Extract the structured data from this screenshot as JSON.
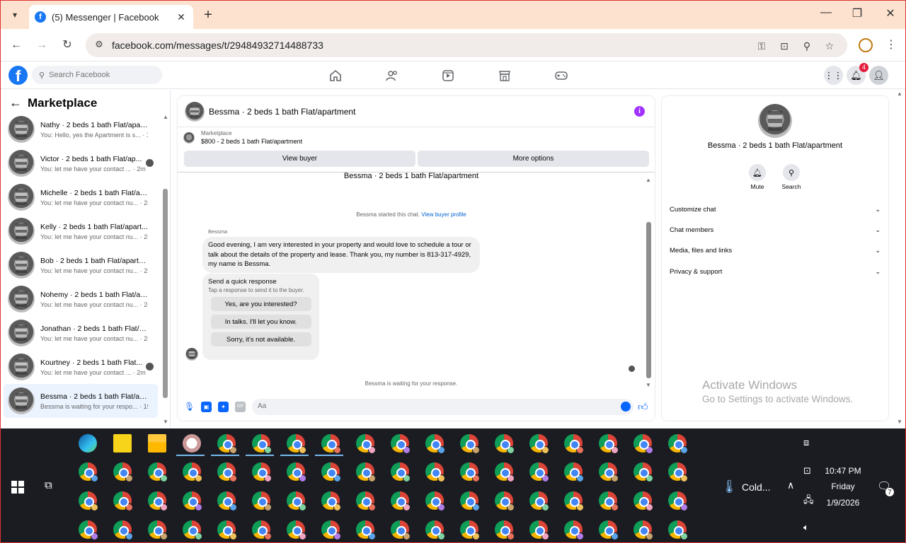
{
  "browser": {
    "tab_title": "(5) Messenger | Facebook",
    "url": "facebook.com/messages/t/29484932714488733",
    "tab_favicon": "f"
  },
  "fb": {
    "search_placeholder": "Search Facebook",
    "notification_count": "4",
    "nav_icons": [
      "home-icon",
      "friends-icon",
      "video-icon",
      "marketplace-icon",
      "gaming-icon"
    ]
  },
  "sidebar": {
    "title": "Marketplace",
    "conversations": [
      {
        "name": "Nathy · 2 beds 1 bath Flat/apar...",
        "preview": "You: Hello, yes the Apartment is s...",
        "time": "1m",
        "seen": false
      },
      {
        "name": "Victor · 2 beds 1 bath Flat/ap...",
        "preview": "You: let me have your contact ...",
        "time": "2m",
        "seen": true
      },
      {
        "name": "Michelle · 2 beds 1 bath Flat/ap...",
        "preview": "You: let me have your contact nu...",
        "time": "2m",
        "seen": false
      },
      {
        "name": "Kelly · 2 beds 1 bath Flat/apart...",
        "preview": "You: let me have your contact nu...",
        "time": "2m",
        "seen": false
      },
      {
        "name": "Bob · 2 beds 1 bath Flat/apartm...",
        "preview": "You: let me have your contact nu...",
        "time": "2m",
        "seen": false
      },
      {
        "name": "Nohemy · 2 beds 1 bath Flat/ap...",
        "preview": "You: let me have your contact nu...",
        "time": "2m",
        "seen": false
      },
      {
        "name": "Jonathan · 2 beds 1 bath Flat/a...",
        "preview": "You: let me have your contact nu...",
        "time": "2m",
        "seen": false
      },
      {
        "name": "Kourtney · 2 beds 1 bath Flat...",
        "preview": "You: let me have your contact ...",
        "time": "2m",
        "seen": true
      },
      {
        "name": "Bessma · 2 beds 1 bath Flat/apa...",
        "preview": "Bessma is waiting for your respo...",
        "time": "19h",
        "seen": false
      }
    ]
  },
  "chat": {
    "title": "Bessma · 2 beds 1 bath Flat/apartment",
    "listing_kind": "Marketplace",
    "listing_desc": "$800 - 2 beds 1 bath Flat/apartment",
    "view_buyer": "View buyer",
    "more_options": "More options",
    "thread_title": "Bessma · 2 beds 1 bath Flat/apartment",
    "started": "Bessma started this chat.",
    "view_profile": "View buyer profile",
    "sender": "Bessma",
    "message": "Good evening, I am very interested in your property and would love to schedule a tour or talk about the details of the property and lease. Thank you, my number is 813-317-4929, my name is Bessma.",
    "quick_title": "Send a quick response",
    "quick_sub": "Tap a response to send it to the buyer.",
    "quick_replies": [
      "Yes, are you interested?",
      "In talks. I'll let you know.",
      "Sorry, it's not available."
    ],
    "waiting": "Bessma is waiting for your response.",
    "composer_placeholder": "Aa",
    "composer_icons": [
      "microphone-icon",
      "photo-icon",
      "sticker-icon",
      "gif-icon"
    ],
    "gif_label": "GIF"
  },
  "details": {
    "name": "Bessma · 2 beds 1 bath Flat/apartment",
    "mute": "Mute",
    "search": "Search",
    "sections": [
      "Customize chat",
      "Chat members",
      "Media, files and links",
      "Privacy & support"
    ]
  },
  "watermark": {
    "line1": "Activate Windows",
    "line2": "Go to Settings to activate Windows."
  },
  "taskbar": {
    "weather": "Cold...",
    "time": "10:47 PM",
    "day": "Friday",
    "date": "1/9/2026",
    "notif_count": "7"
  },
  "colors": {
    "facebook_blue": "#1877f2",
    "messenger_blue": "#0866ff",
    "info_purple": "#a033ff",
    "badge_red": "#e41e3f",
    "tabbar": "#fde2cf",
    "taskbar": "#1a1c22"
  }
}
